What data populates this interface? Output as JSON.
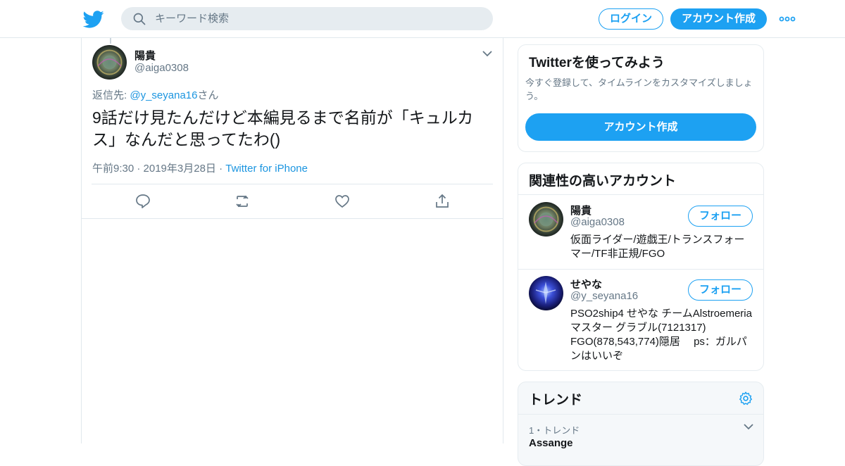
{
  "header": {
    "search_placeholder": "キーワード検索",
    "login_label": "ログイン",
    "signup_label": "アカウント作成"
  },
  "tweet": {
    "author_name": "陽貴",
    "author_handle": "@aiga0308",
    "reply_prefix": "返信先: ",
    "reply_target": "@y_seyana16",
    "reply_suffix": "さん",
    "text": "9話だけ見たんだけど本編見るまで名前が「キュルカス」なんだと思ってたわ()",
    "timestamp": "午前9:30 · 2019年3月28日",
    "separator": " · ",
    "source": "Twitter for iPhone"
  },
  "signup_card": {
    "title": "Twitterを使ってみよう",
    "description": "今すぐ登録して、タイムラインをカスタマイズしましょう。",
    "button_label": "アカウント作成"
  },
  "related": {
    "title": "関連性の高いアカウント",
    "accounts": [
      {
        "name": "陽貴",
        "handle": "@aiga0308",
        "follow_label": "フォロー",
        "bio": "仮面ライダー/遊戯王/トランスフォーマー/TF非正規/FGO"
      },
      {
        "name": "せやな",
        "handle": "@y_seyana16",
        "follow_label": "フォロー",
        "bio": "PSO2ship4 せやな チームAlstroemeria マスター グラブル(7121317) FGO(878,543,774)隠居　 ps：ガルパンはいいぞ"
      }
    ]
  },
  "trends": {
    "title": "トレンド",
    "items": [
      {
        "meta": "1・トレンド",
        "name": "Assange"
      }
    ]
  },
  "colors": {
    "brand": "#1da1f2",
    "link": "#1b95e0",
    "secondary_text": "#657786",
    "border": "#e1e8ed"
  }
}
